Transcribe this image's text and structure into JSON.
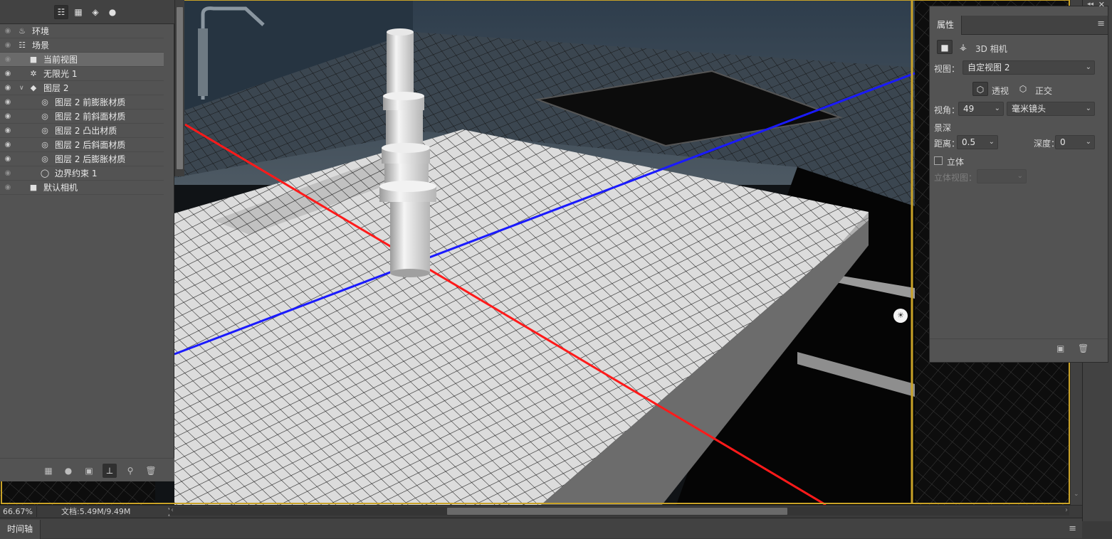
{
  "scene_panel": {
    "tool_icons": [
      "scene-filter-icon",
      "mesh-filter-icon",
      "material-filter-icon",
      "light-filter-icon"
    ],
    "layers": [
      {
        "name": "环境",
        "icon": "environment-icon",
        "indent": 0,
        "eye": "dim"
      },
      {
        "name": "场景",
        "icon": "scene-icon",
        "indent": 0,
        "eye": "dim"
      },
      {
        "name": "当前视图",
        "icon": "camera-icon",
        "indent": 1,
        "eye": "dim",
        "selected": true
      },
      {
        "name": "无限光 1",
        "icon": "infinite-light-icon",
        "indent": 1,
        "eye": "on"
      },
      {
        "name": "图层 2",
        "icon": "mesh-icon",
        "indent": 1,
        "eye": "on",
        "expanded": true
      },
      {
        "name": "图层 2 前膨胀材质",
        "icon": "material-icon",
        "indent": 2,
        "eye": "on"
      },
      {
        "name": "图层 2 前斜面材质",
        "icon": "material-icon",
        "indent": 2,
        "eye": "on"
      },
      {
        "name": "图层 2 凸出材质",
        "icon": "material-icon",
        "indent": 2,
        "eye": "on"
      },
      {
        "name": "图层 2 后斜面材质",
        "icon": "material-icon",
        "indent": 2,
        "eye": "on"
      },
      {
        "name": "图层 2 后膨胀材质",
        "icon": "material-icon",
        "indent": 2,
        "eye": "on"
      },
      {
        "name": "边界约束 1",
        "icon": "constraint-icon",
        "indent": 2,
        "eye": "dim"
      },
      {
        "name": "默认相机",
        "icon": "camera-icon",
        "indent": 1,
        "eye": "dim"
      }
    ],
    "footer_icons": [
      "add-mesh-icon",
      "add-light-icon",
      "add-material-icon",
      "render-icon",
      "constraint-tool-icon",
      "delete-icon"
    ]
  },
  "properties": {
    "tab_label": "属性",
    "header_title": "3D 相机",
    "view_label": "视图：",
    "view_value": "自定视图 2",
    "perspective_label": "透视",
    "ortho_label": "正交",
    "fov_label": "视角：",
    "fov_value": "49",
    "lens_value": "毫米镜头",
    "dof_label": "景深",
    "distance_label": "距离：",
    "distance_value": "0.5",
    "depth_label": "深度：",
    "depth_value": "0",
    "stereo_label": "立体",
    "stereo_checked": false,
    "stereo_view_label": "立体视图：",
    "stereo_view_value": ""
  },
  "status": {
    "zoom": "66.67%",
    "doc_info": "文档:5.49M/9.49M",
    "arrow": "❯"
  },
  "timeline": {
    "tab_label": "时间轴"
  },
  "colors": {
    "panel_bg": "#535353",
    "frame_gold": "#c9a227",
    "axis_red": "#ff1a1a",
    "axis_blue": "#1a1aff"
  }
}
